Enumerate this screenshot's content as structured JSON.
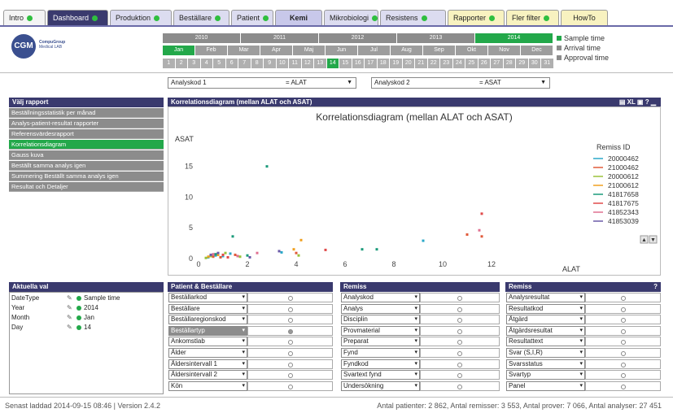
{
  "tabs": [
    {
      "label": "Intro",
      "dot": true
    },
    {
      "label": "Dashboard",
      "dot": true
    },
    {
      "label": "Produktion",
      "dot": true
    },
    {
      "label": "Beställare",
      "dot": true
    },
    {
      "label": "Patient",
      "dot": true
    },
    {
      "label": "Kemi",
      "dot": false
    },
    {
      "label": "Mikrobiologi",
      "dot": true
    },
    {
      "label": "Resistens",
      "dot": true
    },
    {
      "label": "Rapporter",
      "dot": true
    },
    {
      "label": "Fler filter",
      "dot": true
    },
    {
      "label": "HowTo",
      "dot": false
    }
  ],
  "logo": {
    "abbr": "CGM",
    "line1": "CompuGroup",
    "line2": "Medical LAB"
  },
  "years": [
    "2010",
    "2011",
    "2012",
    "2013",
    "2014"
  ],
  "selected_year": "2014",
  "months": [
    "Jan",
    "Feb",
    "Mar",
    "Apr",
    "Maj",
    "Jun",
    "Jul",
    "Aug",
    "Sep",
    "Okt",
    "Nov",
    "Dec"
  ],
  "selected_month": "Jan",
  "days": [
    "1",
    "2",
    "3",
    "4",
    "5",
    "6",
    "7",
    "8",
    "9",
    "10",
    "11",
    "12",
    "13",
    "14",
    "15",
    "16",
    "17",
    "18",
    "19",
    "20",
    "21",
    "22",
    "23",
    "24",
    "25",
    "26",
    "27",
    "28",
    "29",
    "30",
    "31"
  ],
  "selected_day": "14",
  "time_legend": [
    {
      "label": "Sample time",
      "color": "#23a84a"
    },
    {
      "label": "Arrival time",
      "color": "#8c8c8c"
    },
    {
      "label": "Approval time",
      "color": "#8c8c8c"
    }
  ],
  "analyskod1": {
    "label": "Analyskod 1",
    "value": "= ALAT"
  },
  "analyskod2": {
    "label": "Analyskod 2",
    "value": "= ASAT"
  },
  "valj_rapport": {
    "title": "Välj rapport",
    "items": [
      "Beställningsstatistik per månad",
      "Analys-patient-resultat rapporter",
      "Referensvärdesrapport",
      "Korrelationsdiagram",
      "Gauss kuva",
      "Beställt samma analys igen",
      "Summering Beställt samma analys igen",
      "Resultat och Detaljer"
    ],
    "active": "Korrelationsdiagram"
  },
  "chart_panel": {
    "title": "Korrelationsdiagram (mellan ALAT och ASAT)",
    "icons": "XL"
  },
  "chart_data": {
    "type": "scatter",
    "title": "Korrelationsdiagram (mellan ALAT och ASAT)",
    "xlabel": "ALAT",
    "ylabel": "ASAT",
    "xlim": [
      0,
      14
    ],
    "ylim": [
      0,
      18
    ],
    "xticks": [
      "0",
      "2",
      "4",
      "6",
      "8",
      "10",
      "12"
    ],
    "yticks": [
      "0",
      "5",
      "10",
      "15"
    ],
    "legend_title": "Remiss ID",
    "series": [
      {
        "name": "20000462",
        "color": "#2aa8c8",
        "points": [
          [
            0.3,
            0.2
          ],
          [
            0.6,
            0.5
          ],
          [
            1.2,
            0.8
          ],
          [
            3.3,
            1.0
          ],
          [
            9.1,
            2.9
          ],
          [
            0.9,
            0.4
          ]
        ]
      },
      {
        "name": "21000462",
        "color": "#e05a3a",
        "points": [
          [
            0.5,
            0.3
          ],
          [
            1.4,
            0.6
          ],
          [
            3.9,
            0.9
          ],
          [
            10.9,
            3.9
          ],
          [
            11.5,
            3.6
          ],
          [
            0.8,
            0.2
          ]
        ]
      },
      {
        "name": "20000612",
        "color": "#9ac23a",
        "points": [
          [
            0.4,
            0.4
          ],
          [
            1.0,
            0.9
          ],
          [
            4.0,
            0.5
          ],
          [
            1.6,
            0.3
          ],
          [
            0.2,
            0.1
          ]
        ]
      },
      {
        "name": "21000612",
        "color": "#f0a020",
        "points": [
          [
            0.7,
            0.6
          ],
          [
            4.1,
            3.0
          ],
          [
            3.8,
            1.5
          ],
          [
            0.3,
            0.3
          ]
        ]
      },
      {
        "name": "41817658",
        "color": "#1a9a7a",
        "points": [
          [
            2.7,
            15.0
          ],
          [
            1.3,
            3.6
          ],
          [
            7.2,
            1.5
          ],
          [
            6.6,
            1.5
          ],
          [
            1.9,
            0.5
          ],
          [
            0.6,
            0.7
          ]
        ]
      },
      {
        "name": "41817675",
        "color": "#e04a4a",
        "points": [
          [
            11.5,
            7.3
          ],
          [
            0.9,
            0.6
          ],
          [
            5.1,
            1.4
          ],
          [
            1.1,
            0.2
          ]
        ]
      },
      {
        "name": "41852343",
        "color": "#e07090",
        "points": [
          [
            11.4,
            4.6
          ],
          [
            0.5,
            0.7
          ],
          [
            2.3,
            0.9
          ],
          [
            1.5,
            0.4
          ]
        ]
      },
      {
        "name": "41853039",
        "color": "#6a5aa8",
        "points": [
          [
            3.2,
            1.2
          ],
          [
            0.7,
            0.9
          ],
          [
            2.0,
            0.2
          ],
          [
            0.4,
            0.6
          ]
        ]
      }
    ]
  },
  "aktuella_val": {
    "title": "Aktuella val",
    "rows": [
      {
        "name": "DateType",
        "value": "Sample time"
      },
      {
        "name": "Year",
        "value": "2014"
      },
      {
        "name": "Month",
        "value": "Jan"
      },
      {
        "name": "Day",
        "value": "14"
      }
    ]
  },
  "patient_panel": {
    "title": "Patient & Beställare",
    "rows": [
      "Beställarkod",
      "Beställare",
      "Beställaregionskod",
      "Beställartyp",
      "Ankomstlab",
      "Ålder",
      "Åldersintervall 1",
      "Åldersintervall 2",
      "Kön"
    ],
    "highlight": "Beställartyp"
  },
  "remiss_panel1": {
    "title": "Remiss",
    "rows": [
      "Analyskod",
      "Analys",
      "Disciplin",
      "Provmaterial",
      "Preparat",
      "Fynd",
      "Fyndkod",
      "Svartext fynd",
      "Undersökning"
    ]
  },
  "remiss_panel2": {
    "title": "Remiss",
    "rows": [
      "Analysresultat",
      "Resultatkod",
      "Åtgärd",
      "Åtgärdsresultat",
      "Resultattext",
      "Svar (S,I,R)",
      "Svarsstatus",
      "Svartyp",
      "Panel"
    ]
  },
  "footer": {
    "left": "Senast laddad 2014-09-15 08:46 | Version 2.4.2",
    "right": "Antal patienter: 2 862, Antal remisser: 3 553, Antal prover: 7 066, Antal analyser: 27 451"
  }
}
